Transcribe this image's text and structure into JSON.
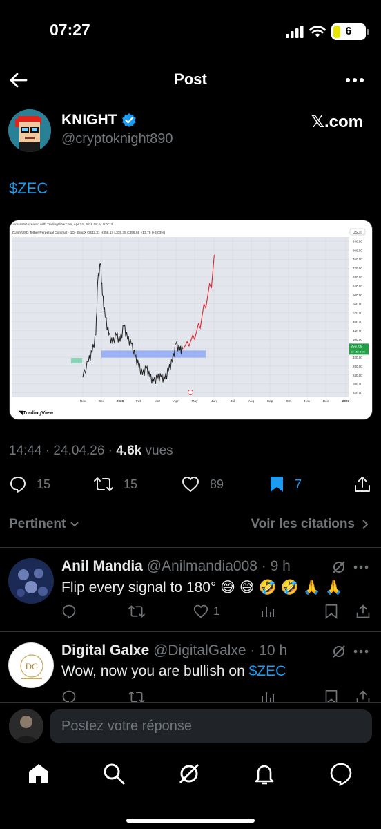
{
  "status_bar": {
    "time": "07:27",
    "battery": "6"
  },
  "header": {
    "title": "Post"
  },
  "author": {
    "name": "KNIGHT",
    "handle": "@cryptoknight890",
    "source": "𝕏.com"
  },
  "tweet": {
    "text": "$ZEC"
  },
  "chart_image": {
    "watermark": "usman890 created with TradingView.com, Apr 24, 2026 08:44 UTC-3",
    "symbol_line": "Zcash/USD Tether Perpetual Contract · 1D · BingX   O342.31  H358.17  L335.35  C356.08  +13.79 (+4.03%)",
    "currency": "USDT",
    "brand": "TradingView",
    "price_tag": "356.08",
    "price_tag2": "1d 15h 16m",
    "chart_data": {
      "type": "line",
      "title": "Zcash/USD Tether Perpetual Contract · 1D · BingX",
      "ylabel": "USDT",
      "y_ticks": [
        840,
        800,
        760,
        720,
        680,
        640,
        600,
        560,
        520,
        480,
        440,
        400,
        360,
        320,
        280,
        240,
        200,
        160
      ],
      "x_ticks": [
        "Nov",
        "Dec",
        "2026",
        "Feb",
        "Mar",
        "Apr",
        "May",
        "Jun",
        "Jul",
        "Aug",
        "Sep",
        "Oct",
        "Nov",
        "Dec",
        "2027"
      ],
      "ylim": [
        140,
        860
      ],
      "support_zone": [
        318,
        350
      ],
      "last_close": 356.08,
      "price_series": [
        [
          0.2,
          230
        ],
        [
          0.5,
          300
        ],
        [
          0.7,
          340
        ],
        [
          0.9,
          420
        ],
        [
          1.0,
          660
        ],
        [
          1.15,
          740
        ],
        [
          1.25,
          600
        ],
        [
          1.4,
          500
        ],
        [
          1.6,
          420
        ],
        [
          1.8,
          380
        ],
        [
          2.0,
          420
        ],
        [
          2.2,
          390
        ],
        [
          2.4,
          460
        ],
        [
          2.6,
          400
        ],
        [
          2.8,
          380
        ],
        [
          3.0,
          320
        ],
        [
          3.2,
          280
        ],
        [
          3.4,
          240
        ],
        [
          3.6,
          270
        ],
        [
          3.8,
          230
        ],
        [
          4.0,
          210
        ],
        [
          4.2,
          225
        ],
        [
          4.4,
          230
        ],
        [
          4.6,
          220
        ],
        [
          4.8,
          260
        ],
        [
          5.0,
          300
        ],
        [
          5.2,
          380
        ],
        [
          5.4,
          350
        ],
        [
          5.55,
          356
        ]
      ],
      "projection_series": [
        [
          5.6,
          356
        ],
        [
          5.8,
          390
        ],
        [
          5.9,
          370
        ],
        [
          6.1,
          420
        ],
        [
          6.2,
          400
        ],
        [
          6.4,
          470
        ],
        [
          6.5,
          450
        ],
        [
          6.7,
          560
        ],
        [
          6.8,
          540
        ],
        [
          7.0,
          650
        ],
        [
          7.1,
          630
        ],
        [
          7.25,
          780
        ]
      ]
    }
  },
  "meta": {
    "time": "14:44 · 24.04.26 · ",
    "views": "4.6k",
    "views_label": " vues"
  },
  "actions": {
    "replies": "15",
    "reposts": "15",
    "likes": "89",
    "bookmarks": "7"
  },
  "sort": {
    "label": "Pertinent",
    "citations": "Voir les citations"
  },
  "replies": [
    {
      "name": "Anil Mandia",
      "handle": "@Anilmandia008 · 9 h",
      "text": "Flip every signal to 180° 😅 😅 🤣 🤣 🙏 🙏",
      "likes": "1"
    },
    {
      "name": "Digital Galxe",
      "handle": "@DigitalGalxe · 10 h",
      "text_prefix": "Wow, now you are bullish on ",
      "text_tag": "$ZEC"
    }
  ],
  "composer": {
    "placeholder": "Postez votre réponse"
  },
  "colors": {
    "accent": "#1d9bf0",
    "background": "#000000",
    "muted": "#71767b"
  }
}
